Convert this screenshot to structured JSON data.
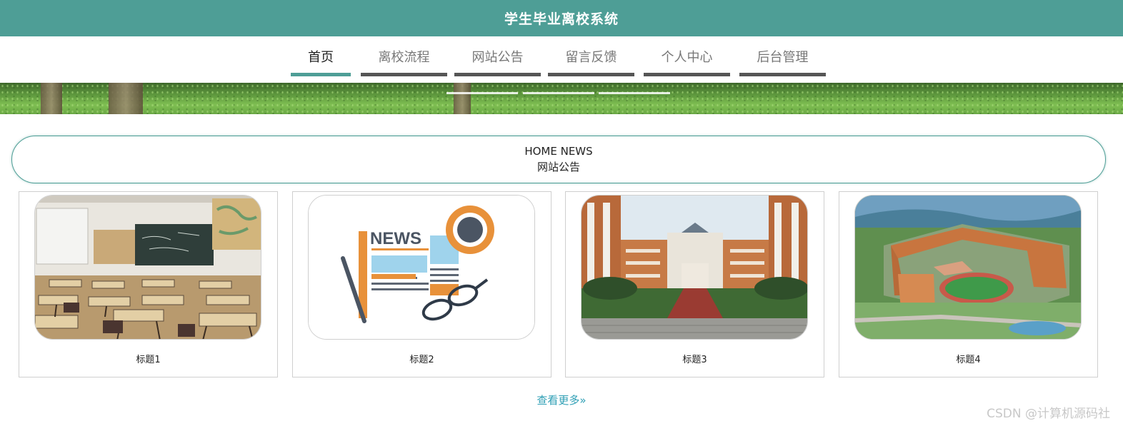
{
  "header": {
    "title": "学生毕业离校系统"
  },
  "nav": {
    "items": [
      {
        "label": "首页",
        "active": true
      },
      {
        "label": "离校流程",
        "active": false
      },
      {
        "label": "网站公告",
        "active": false
      },
      {
        "label": "留言反馈",
        "active": false
      },
      {
        "label": "个人中心",
        "active": false
      },
      {
        "label": "后台管理",
        "active": false
      }
    ]
  },
  "section": {
    "title_en": "HOME NEWS",
    "title_cn": "网站公告"
  },
  "news": [
    {
      "caption": "标题1",
      "image": "classroom-photo"
    },
    {
      "caption": "标题2",
      "image": "news-illustration"
    },
    {
      "caption": "标题3",
      "image": "campus-building-photo"
    },
    {
      "caption": "标题4",
      "image": "campus-aerial-rendering"
    }
  ],
  "more": {
    "label": "查看更多»"
  },
  "watermark": {
    "text": "CSDN @计算机源码社"
  },
  "colors": {
    "primary": "#4e9e96",
    "link": "#2f9fb5",
    "nav_bar": "#555555"
  }
}
